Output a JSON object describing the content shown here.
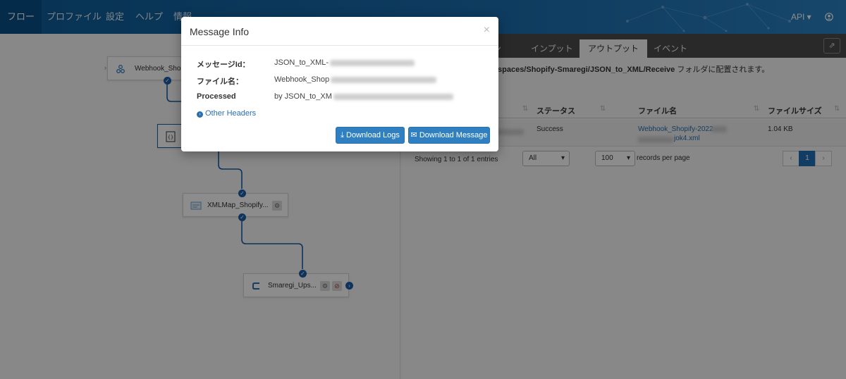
{
  "navbar": {
    "items": [
      "フロー",
      "プロファイル",
      "設定",
      "ヘルプ",
      "情報"
    ],
    "api_label": "API ▾",
    "user_icon": "user-circle-icon"
  },
  "flow": {
    "nodes": [
      {
        "label": "Webhook_Shop",
        "icon": "webhook-icon"
      },
      {
        "label": "",
        "icon": "json-icon"
      },
      {
        "label": "XMLMap_Shopify...",
        "icon": "xmlmap-icon"
      },
      {
        "label": "Smaregi_Ups...",
        "icon": "connector-icon"
      }
    ]
  },
  "right_panel": {
    "tabs": [
      "ン",
      "インプット",
      "アウトプット",
      "イベント"
    ],
    "active_tab": "アウトプット",
    "path_bold": "spaces/Shopify-Smaregi/JSON_to_XML/Receive",
    "path_suffix": " フォルダに配置されます。",
    "columns": {
      "status": "ステータス",
      "filename": "ファイル名",
      "filesize": "ファイルサイズ"
    },
    "row": {
      "status": "Success",
      "filename_line1": "Webhook_Shopify-2022",
      "filename_line2": "jok4.xml",
      "filesize": "1.04 KB"
    },
    "showing": "Showing 1 to 1 of 1 entries",
    "filter_value": "All",
    "per_page_value": "100",
    "per_page_label": "records per page",
    "pager": {
      "prev": "‹",
      "current": "1",
      "next": "›"
    }
  },
  "modal": {
    "title": "Message Info",
    "close": "×",
    "fields": [
      {
        "key": "メッセージId：",
        "value": "JSON_to_XML-"
      },
      {
        "key": "ファイル名：",
        "value": "Webhook_Shop"
      },
      {
        "key": "Processed",
        "value": "by JSON_to_XM"
      }
    ],
    "other_headers": "Other Headers",
    "download_logs": "Download Logs",
    "download_message": "Download Message"
  },
  "colors": {
    "navbar": "#1a6eaf",
    "primary": "#2f7fc1",
    "port": "#1b5ea8",
    "tabbar": "#4b4b4b"
  }
}
